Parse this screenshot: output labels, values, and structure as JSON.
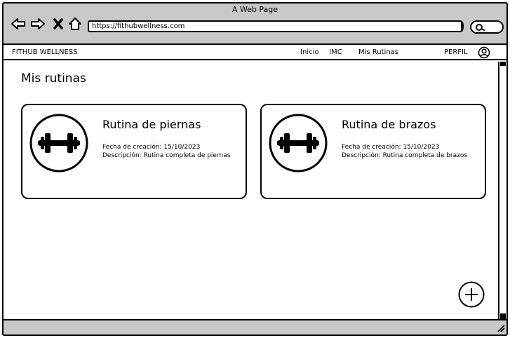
{
  "window": {
    "title": "A Web Page"
  },
  "browser": {
    "url": "https://fithubwellness.com",
    "icons": [
      "back-arrow-icon",
      "forward-arrow-icon",
      "close-x-icon",
      "home-icon",
      "search-icon"
    ]
  },
  "navbar": {
    "brand": "FITHUB WELLNESS",
    "links": [
      {
        "label": "Inicio"
      },
      {
        "label": "IMC"
      },
      {
        "label": "Mis Rutinas"
      }
    ],
    "profile_label": "PERFIL",
    "profile_icon": "user-icon"
  },
  "page": {
    "title": "Mis rutinas",
    "routines": [
      {
        "title": "Rutina de piernas",
        "date": "Fecha de creación: 15/10/2023",
        "description": "Descripción: Rutina completa de piernas",
        "icon": "dumbbell-icon"
      },
      {
        "title": "Rutina de brazos",
        "date": "Fecha de creación: 15/10/2023",
        "description": "Descripción: Rutina completa de brazos",
        "icon": "dumbbell-icon"
      }
    ],
    "add_icon": "plus-icon"
  }
}
